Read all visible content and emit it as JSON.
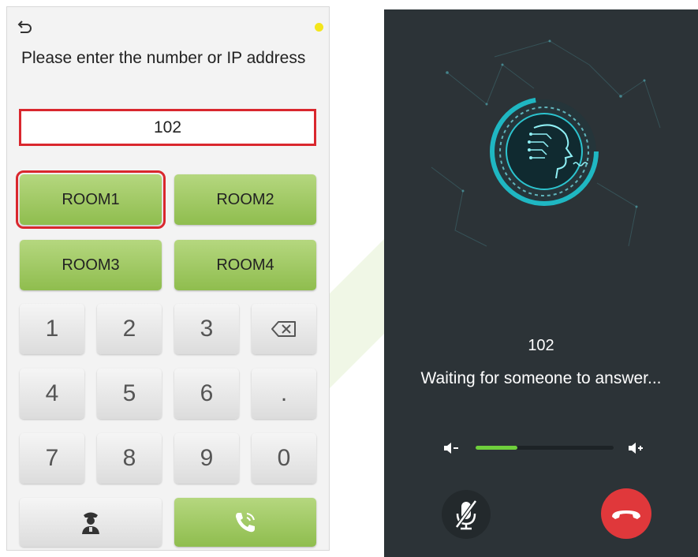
{
  "dialer": {
    "prompt": "Please enter the number or IP address",
    "input_value": "102",
    "rooms": [
      "ROOM1",
      "ROOM2",
      "ROOM3",
      "ROOM4"
    ],
    "keys": [
      "1",
      "2",
      "3",
      "4",
      "5",
      "6",
      ".",
      "7",
      "8",
      "9",
      "0"
    ],
    "icons": {
      "back": "back-arrow-icon",
      "indicator": "status-dot",
      "backspace": "backspace-icon",
      "guard": "security-guard-icon",
      "call": "phone-call-icon"
    }
  },
  "call_screen": {
    "number": "102",
    "status": "Waiting for someone to answer...",
    "volume_level": 0.3,
    "icons": {
      "avatar": "face-scan-icon",
      "volume_down": "volume-down-icon",
      "volume_up": "volume-up-icon",
      "mute": "mic-muted-icon",
      "hangup": "hang-up-icon"
    }
  },
  "colors": {
    "room_button": "#9dc760",
    "selection": "#d9272e",
    "call_bg": "#2c3337",
    "volume_fill": "#6fcf3c",
    "hangup": "#e0383b",
    "indicator": "#f3e51b"
  }
}
